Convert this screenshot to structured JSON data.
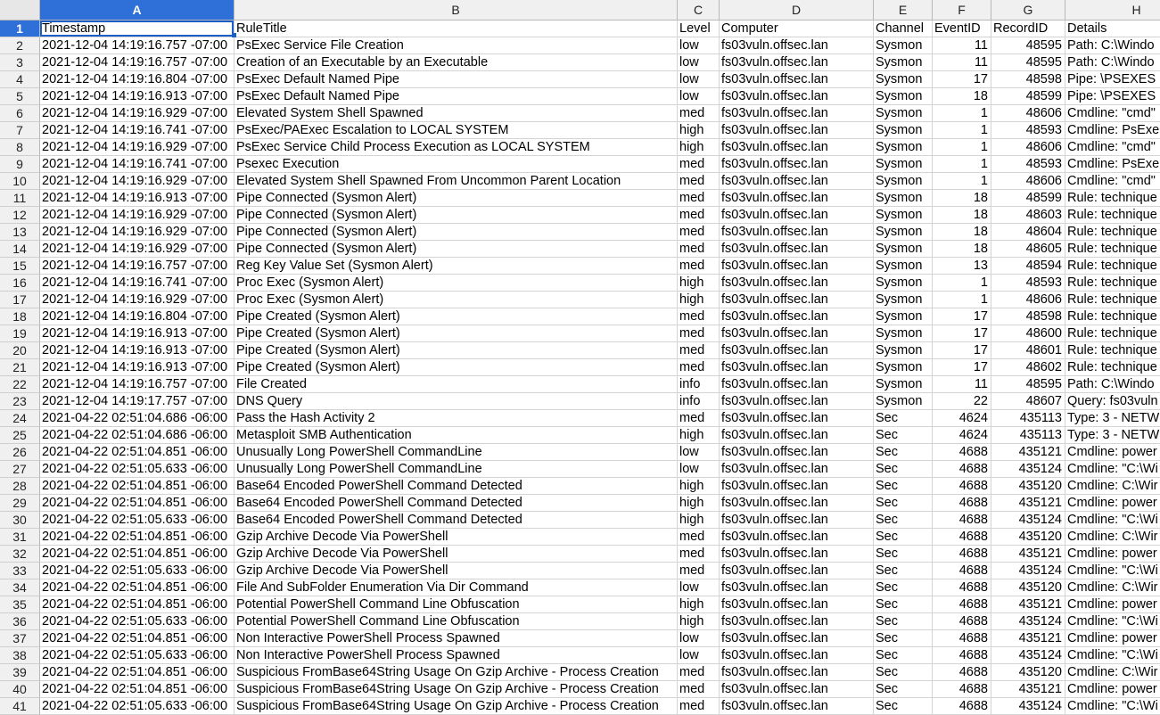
{
  "columns": [
    "A",
    "B",
    "C",
    "D",
    "E",
    "F",
    "G",
    "H"
  ],
  "selected_column": "A",
  "selected_row": 1,
  "header": {
    "row": "1",
    "cells": [
      "Timestamp",
      "RuleTitle",
      "Level",
      "Computer",
      "Channel",
      "EventID",
      "RecordID",
      "Details"
    ]
  },
  "rows": [
    {
      "row": "2",
      "cells": [
        "2021-12-04 14:19:16.757 -07:00",
        "PsExec Service File Creation",
        "low",
        "fs03vuln.offsec.lan",
        "Sysmon",
        "11",
        "48595",
        "Path: C:\\Windo"
      ]
    },
    {
      "row": "3",
      "cells": [
        "2021-12-04 14:19:16.757 -07:00",
        "Creation of an Executable by an Executable",
        "low",
        "fs03vuln.offsec.lan",
        "Sysmon",
        "11",
        "48595",
        "Path: C:\\Windo"
      ]
    },
    {
      "row": "4",
      "cells": [
        "2021-12-04 14:19:16.804 -07:00",
        "PsExec Default Named Pipe",
        "low",
        "fs03vuln.offsec.lan",
        "Sysmon",
        "17",
        "48598",
        "Pipe: \\PSEXES"
      ]
    },
    {
      "row": "5",
      "cells": [
        "2021-12-04 14:19:16.913 -07:00",
        "PsExec Default Named Pipe",
        "low",
        "fs03vuln.offsec.lan",
        "Sysmon",
        "18",
        "48599",
        "Pipe: \\PSEXES"
      ]
    },
    {
      "row": "6",
      "cells": [
        "2021-12-04 14:19:16.929 -07:00",
        "Elevated System Shell Spawned",
        "med",
        "fs03vuln.offsec.lan",
        "Sysmon",
        "1",
        "48606",
        "Cmdline: \"cmd\""
      ]
    },
    {
      "row": "7",
      "cells": [
        "2021-12-04 14:19:16.741 -07:00",
        "PsExec/PAExec Escalation to LOCAL SYSTEM",
        "high",
        "fs03vuln.offsec.lan",
        "Sysmon",
        "1",
        "48593",
        "Cmdline: PsExe"
      ]
    },
    {
      "row": "8",
      "cells": [
        "2021-12-04 14:19:16.929 -07:00",
        "PsExec Service Child Process Execution as LOCAL SYSTEM",
        "high",
        "fs03vuln.offsec.lan",
        "Sysmon",
        "1",
        "48606",
        "Cmdline: \"cmd\""
      ]
    },
    {
      "row": "9",
      "cells": [
        "2021-12-04 14:19:16.741 -07:00",
        "Psexec Execution",
        "med",
        "fs03vuln.offsec.lan",
        "Sysmon",
        "1",
        "48593",
        "Cmdline: PsExe"
      ]
    },
    {
      "row": "10",
      "cells": [
        "2021-12-04 14:19:16.929 -07:00",
        "Elevated System Shell Spawned From Uncommon Parent Location",
        "med",
        "fs03vuln.offsec.lan",
        "Sysmon",
        "1",
        "48606",
        "Cmdline: \"cmd\""
      ]
    },
    {
      "row": "11",
      "cells": [
        "2021-12-04 14:19:16.913 -07:00",
        "Pipe Connected (Sysmon Alert)",
        "med",
        "fs03vuln.offsec.lan",
        "Sysmon",
        "18",
        "48599",
        "Rule: technique"
      ]
    },
    {
      "row": "12",
      "cells": [
        "2021-12-04 14:19:16.929 -07:00",
        "Pipe Connected (Sysmon Alert)",
        "med",
        "fs03vuln.offsec.lan",
        "Sysmon",
        "18",
        "48603",
        "Rule: technique"
      ]
    },
    {
      "row": "13",
      "cells": [
        "2021-12-04 14:19:16.929 -07:00",
        "Pipe Connected (Sysmon Alert)",
        "med",
        "fs03vuln.offsec.lan",
        "Sysmon",
        "18",
        "48604",
        "Rule: technique"
      ]
    },
    {
      "row": "14",
      "cells": [
        "2021-12-04 14:19:16.929 -07:00",
        "Pipe Connected (Sysmon Alert)",
        "med",
        "fs03vuln.offsec.lan",
        "Sysmon",
        "18",
        "48605",
        "Rule: technique"
      ]
    },
    {
      "row": "15",
      "cells": [
        "2021-12-04 14:19:16.757 -07:00",
        "Reg Key Value Set (Sysmon Alert)",
        "med",
        "fs03vuln.offsec.lan",
        "Sysmon",
        "13",
        "48594",
        "Rule: technique"
      ]
    },
    {
      "row": "16",
      "cells": [
        "2021-12-04 14:19:16.741 -07:00",
        "Proc Exec (Sysmon Alert)",
        "high",
        "fs03vuln.offsec.lan",
        "Sysmon",
        "1",
        "48593",
        "Rule: technique"
      ]
    },
    {
      "row": "17",
      "cells": [
        "2021-12-04 14:19:16.929 -07:00",
        "Proc Exec (Sysmon Alert)",
        "high",
        "fs03vuln.offsec.lan",
        "Sysmon",
        "1",
        "48606",
        "Rule: technique"
      ]
    },
    {
      "row": "18",
      "cells": [
        "2021-12-04 14:19:16.804 -07:00",
        "Pipe Created (Sysmon Alert)",
        "med",
        "fs03vuln.offsec.lan",
        "Sysmon",
        "17",
        "48598",
        "Rule: technique"
      ]
    },
    {
      "row": "19",
      "cells": [
        "2021-12-04 14:19:16.913 -07:00",
        "Pipe Created (Sysmon Alert)",
        "med",
        "fs03vuln.offsec.lan",
        "Sysmon",
        "17",
        "48600",
        "Rule: technique"
      ]
    },
    {
      "row": "20",
      "cells": [
        "2021-12-04 14:19:16.913 -07:00",
        "Pipe Created (Sysmon Alert)",
        "med",
        "fs03vuln.offsec.lan",
        "Sysmon",
        "17",
        "48601",
        "Rule: technique"
      ]
    },
    {
      "row": "21",
      "cells": [
        "2021-12-04 14:19:16.913 -07:00",
        "Pipe Created (Sysmon Alert)",
        "med",
        "fs03vuln.offsec.lan",
        "Sysmon",
        "17",
        "48602",
        "Rule: technique"
      ]
    },
    {
      "row": "22",
      "cells": [
        "2021-12-04 14:19:16.757 -07:00",
        "File Created",
        "info",
        "fs03vuln.offsec.lan",
        "Sysmon",
        "11",
        "48595",
        "Path: C:\\Windo"
      ]
    },
    {
      "row": "23",
      "cells": [
        "2021-12-04 14:19:17.757 -07:00",
        "DNS Query",
        "info",
        "fs03vuln.offsec.lan",
        "Sysmon",
        "22",
        "48607",
        "Query: fs03vuln"
      ]
    },
    {
      "row": "24",
      "cells": [
        "2021-04-22 02:51:04.686 -06:00",
        "Pass the Hash Activity 2",
        "med",
        "fs03vuln.offsec.lan",
        "Sec",
        "4624",
        "435113",
        "Type: 3 - NETW"
      ]
    },
    {
      "row": "25",
      "cells": [
        "2021-04-22 02:51:04.686 -06:00",
        "Metasploit SMB Authentication",
        "high",
        "fs03vuln.offsec.lan",
        "Sec",
        "4624",
        "435113",
        "Type: 3 - NETW"
      ]
    },
    {
      "row": "26",
      "cells": [
        "2021-04-22 02:51:04.851 -06:00",
        "Unusually Long PowerShell CommandLine",
        "low",
        "fs03vuln.offsec.lan",
        "Sec",
        "4688",
        "435121",
        "Cmdline: power"
      ]
    },
    {
      "row": "27",
      "cells": [
        "2021-04-22 02:51:05.633 -06:00",
        "Unusually Long PowerShell CommandLine",
        "low",
        "fs03vuln.offsec.lan",
        "Sec",
        "4688",
        "435124",
        "Cmdline: \"C:\\Wi"
      ]
    },
    {
      "row": "28",
      "cells": [
        "2021-04-22 02:51:04.851 -06:00",
        "Base64 Encoded PowerShell Command Detected",
        "high",
        "fs03vuln.offsec.lan",
        "Sec",
        "4688",
        "435120",
        "Cmdline: C:\\Wir"
      ]
    },
    {
      "row": "29",
      "cells": [
        "2021-04-22 02:51:04.851 -06:00",
        "Base64 Encoded PowerShell Command Detected",
        "high",
        "fs03vuln.offsec.lan",
        "Sec",
        "4688",
        "435121",
        "Cmdline: power"
      ]
    },
    {
      "row": "30",
      "cells": [
        "2021-04-22 02:51:05.633 -06:00",
        "Base64 Encoded PowerShell Command Detected",
        "high",
        "fs03vuln.offsec.lan",
        "Sec",
        "4688",
        "435124",
        "Cmdline: \"C:\\Wi"
      ]
    },
    {
      "row": "31",
      "cells": [
        "2021-04-22 02:51:04.851 -06:00",
        "Gzip Archive Decode Via PowerShell",
        "med",
        "fs03vuln.offsec.lan",
        "Sec",
        "4688",
        "435120",
        "Cmdline: C:\\Wir"
      ]
    },
    {
      "row": "32",
      "cells": [
        "2021-04-22 02:51:04.851 -06:00",
        "Gzip Archive Decode Via PowerShell",
        "med",
        "fs03vuln.offsec.lan",
        "Sec",
        "4688",
        "435121",
        "Cmdline: power"
      ]
    },
    {
      "row": "33",
      "cells": [
        "2021-04-22 02:51:05.633 -06:00",
        "Gzip Archive Decode Via PowerShell",
        "med",
        "fs03vuln.offsec.lan",
        "Sec",
        "4688",
        "435124",
        "Cmdline: \"C:\\Wi"
      ]
    },
    {
      "row": "34",
      "cells": [
        "2021-04-22 02:51:04.851 -06:00",
        "File And SubFolder Enumeration Via Dir Command",
        "low",
        "fs03vuln.offsec.lan",
        "Sec",
        "4688",
        "435120",
        "Cmdline: C:\\Wir"
      ]
    },
    {
      "row": "35",
      "cells": [
        "2021-04-22 02:51:04.851 -06:00",
        "Potential PowerShell Command Line Obfuscation",
        "high",
        "fs03vuln.offsec.lan",
        "Sec",
        "4688",
        "435121",
        "Cmdline: power"
      ]
    },
    {
      "row": "36",
      "cells": [
        "2021-04-22 02:51:05.633 -06:00",
        "Potential PowerShell Command Line Obfuscation",
        "high",
        "fs03vuln.offsec.lan",
        "Sec",
        "4688",
        "435124",
        "Cmdline: \"C:\\Wi"
      ]
    },
    {
      "row": "37",
      "cells": [
        "2021-04-22 02:51:04.851 -06:00",
        "Non Interactive PowerShell Process Spawned",
        "low",
        "fs03vuln.offsec.lan",
        "Sec",
        "4688",
        "435121",
        "Cmdline: power"
      ]
    },
    {
      "row": "38",
      "cells": [
        "2021-04-22 02:51:05.633 -06:00",
        "Non Interactive PowerShell Process Spawned",
        "low",
        "fs03vuln.offsec.lan",
        "Sec",
        "4688",
        "435124",
        "Cmdline: \"C:\\Wi"
      ]
    },
    {
      "row": "39",
      "cells": [
        "2021-04-22 02:51:04.851 -06:00",
        "Suspicious FromBase64String Usage On Gzip Archive - Process Creation",
        "med",
        "fs03vuln.offsec.lan",
        "Sec",
        "4688",
        "435120",
        "Cmdline: C:\\Wir"
      ]
    },
    {
      "row": "40",
      "cells": [
        "2021-04-22 02:51:04.851 -06:00",
        "Suspicious FromBase64String Usage On Gzip Archive - Process Creation",
        "med",
        "fs03vuln.offsec.lan",
        "Sec",
        "4688",
        "435121",
        "Cmdline: power"
      ]
    },
    {
      "row": "41",
      "cells": [
        "2021-04-22 02:51:05.633 -06:00",
        "Suspicious FromBase64String Usage On Gzip Archive - Process Creation",
        "med",
        "fs03vuln.offsec.lan",
        "Sec",
        "4688",
        "435124",
        "Cmdline: \"C:\\Wi"
      ]
    }
  ]
}
